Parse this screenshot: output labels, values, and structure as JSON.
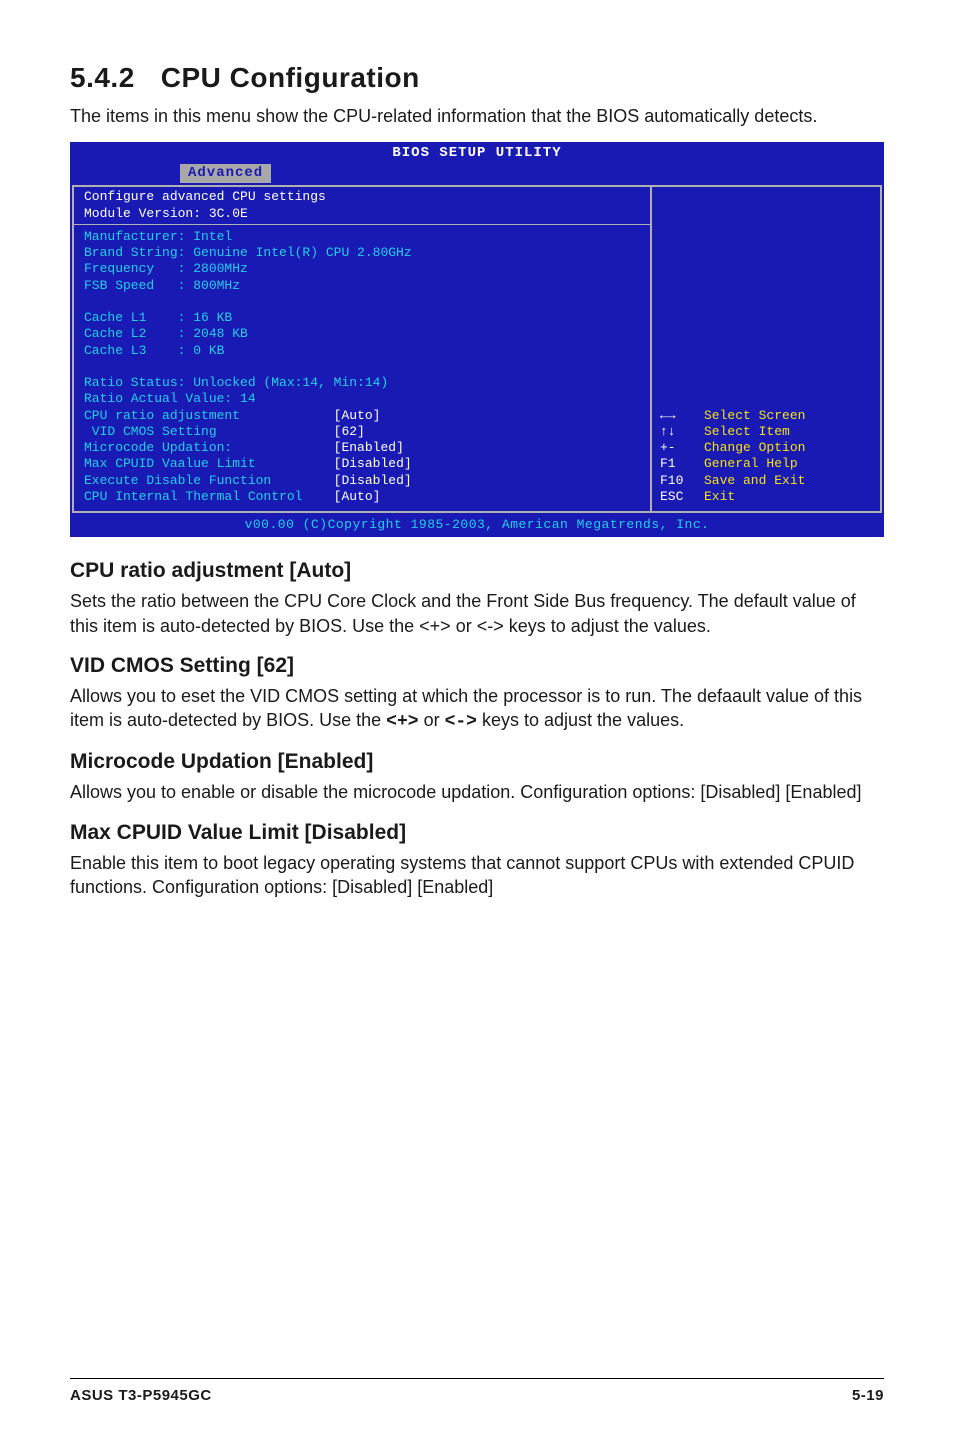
{
  "section": {
    "number": "5.4.2",
    "title": "CPU Configuration",
    "intro": "The items in this menu show the CPU-related information that the BIOS automatically detects."
  },
  "bios": {
    "title": "BIOS SETUP UTILITY",
    "tab": "Advanced",
    "topline1": "Configure advanced CPU settings",
    "topline2": "Module Version: 3C.0E",
    "info": {
      "l1": "Manufacturer: Intel",
      "l2": "Brand String: Genuine Intel(R) CPU 2.80GHz",
      "l3": "Frequency   : 2800MHz",
      "l4": "FSB Speed   : 800MHz",
      "l5": "Cache L1    : 16 KB",
      "l6": "Cache L2    : 2048 KB",
      "l7": "Cache L3    : 0 KB",
      "l8": "Ratio Status: Unlocked (Max:14, Min:14)",
      "l9": "Ratio Actual Value: 14"
    },
    "opts": [
      {
        "label": "CPU ratio adjustment",
        "value": "[Auto]"
      },
      {
        "label": " VID CMOS Setting",
        "value": "[62]"
      },
      {
        "label": "Microcode Updation:",
        "value": "[Enabled]"
      },
      {
        "label": "Max CPUID Vaalue Limit",
        "value": "[Disabled]"
      },
      {
        "label": "Execute Disable Function",
        "value": "[Disabled]"
      },
      {
        "label": "CPU Internal Thermal Control",
        "value": "[Auto]"
      }
    ],
    "help": [
      {
        "key": "←→",
        "txt": "Select Screen"
      },
      {
        "key": "↑↓",
        "txt": "Select Item"
      },
      {
        "key": "+-",
        "txt": "Change Option"
      },
      {
        "key": "F1",
        "txt": "General Help"
      },
      {
        "key": "F10",
        "txt": "Save and Exit"
      },
      {
        "key": "ESC",
        "txt": "Exit"
      }
    ],
    "footer": "v00.00 (C)Copyright 1985-2003, American Megatrends, Inc."
  },
  "sub1": {
    "head": "CPU ratio adjustment [Auto]",
    "body": "Sets the ratio between the CPU Core Clock and the Front Side Bus frequency. The default value of this item is auto-detected by BIOS. Use the <+> or <-> keys to adjust the values."
  },
  "sub2": {
    "head": "VID CMOS Setting [62]",
    "body_a": "Allows you to eset the VID CMOS setting at which the processor is to run. The defaault value of this item is auto-detected by BIOS. Use the ",
    "key1": "<+>",
    "mid": " or ",
    "key2": "<->",
    "body_b": " keys to adjust the values."
  },
  "sub3": {
    "head": "Microcode Updation [Enabled]",
    "body": "Allows you to enable or disable the microcode updation. Configuration options: [Disabled] [Enabled]"
  },
  "sub4": {
    "head": "Max CPUID Value Limit [Disabled]",
    "body": "Enable this item to boot legacy operating systems that cannot support CPUs with extended CPUID functions. Configuration options: [Disabled] [Enabled]"
  },
  "footer": {
    "left": "ASUS T3-P5945GC",
    "right": "5-19"
  }
}
